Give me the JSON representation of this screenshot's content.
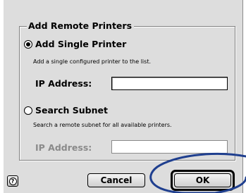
{
  "dialog": {
    "group_title": "Add Remote Printers",
    "single": {
      "label": "Add Single Printer",
      "description": "Add a single configured printer to the list.",
      "field_label": "IP Address:",
      "field_value": "",
      "selected": true
    },
    "subnet": {
      "label": "Search Subnet",
      "description": "Search a remote subnet for all available printers.",
      "field_label": "IP Address:",
      "field_value": "",
      "selected": false
    }
  },
  "buttons": {
    "help_label": "?",
    "cancel_label": "Cancel",
    "ok_label": "OK"
  },
  "annotation": {
    "color": "#1f3f8f"
  },
  "icons": [
    "help-icon",
    "radio-selected-icon",
    "radio-unselected-icon"
  ]
}
